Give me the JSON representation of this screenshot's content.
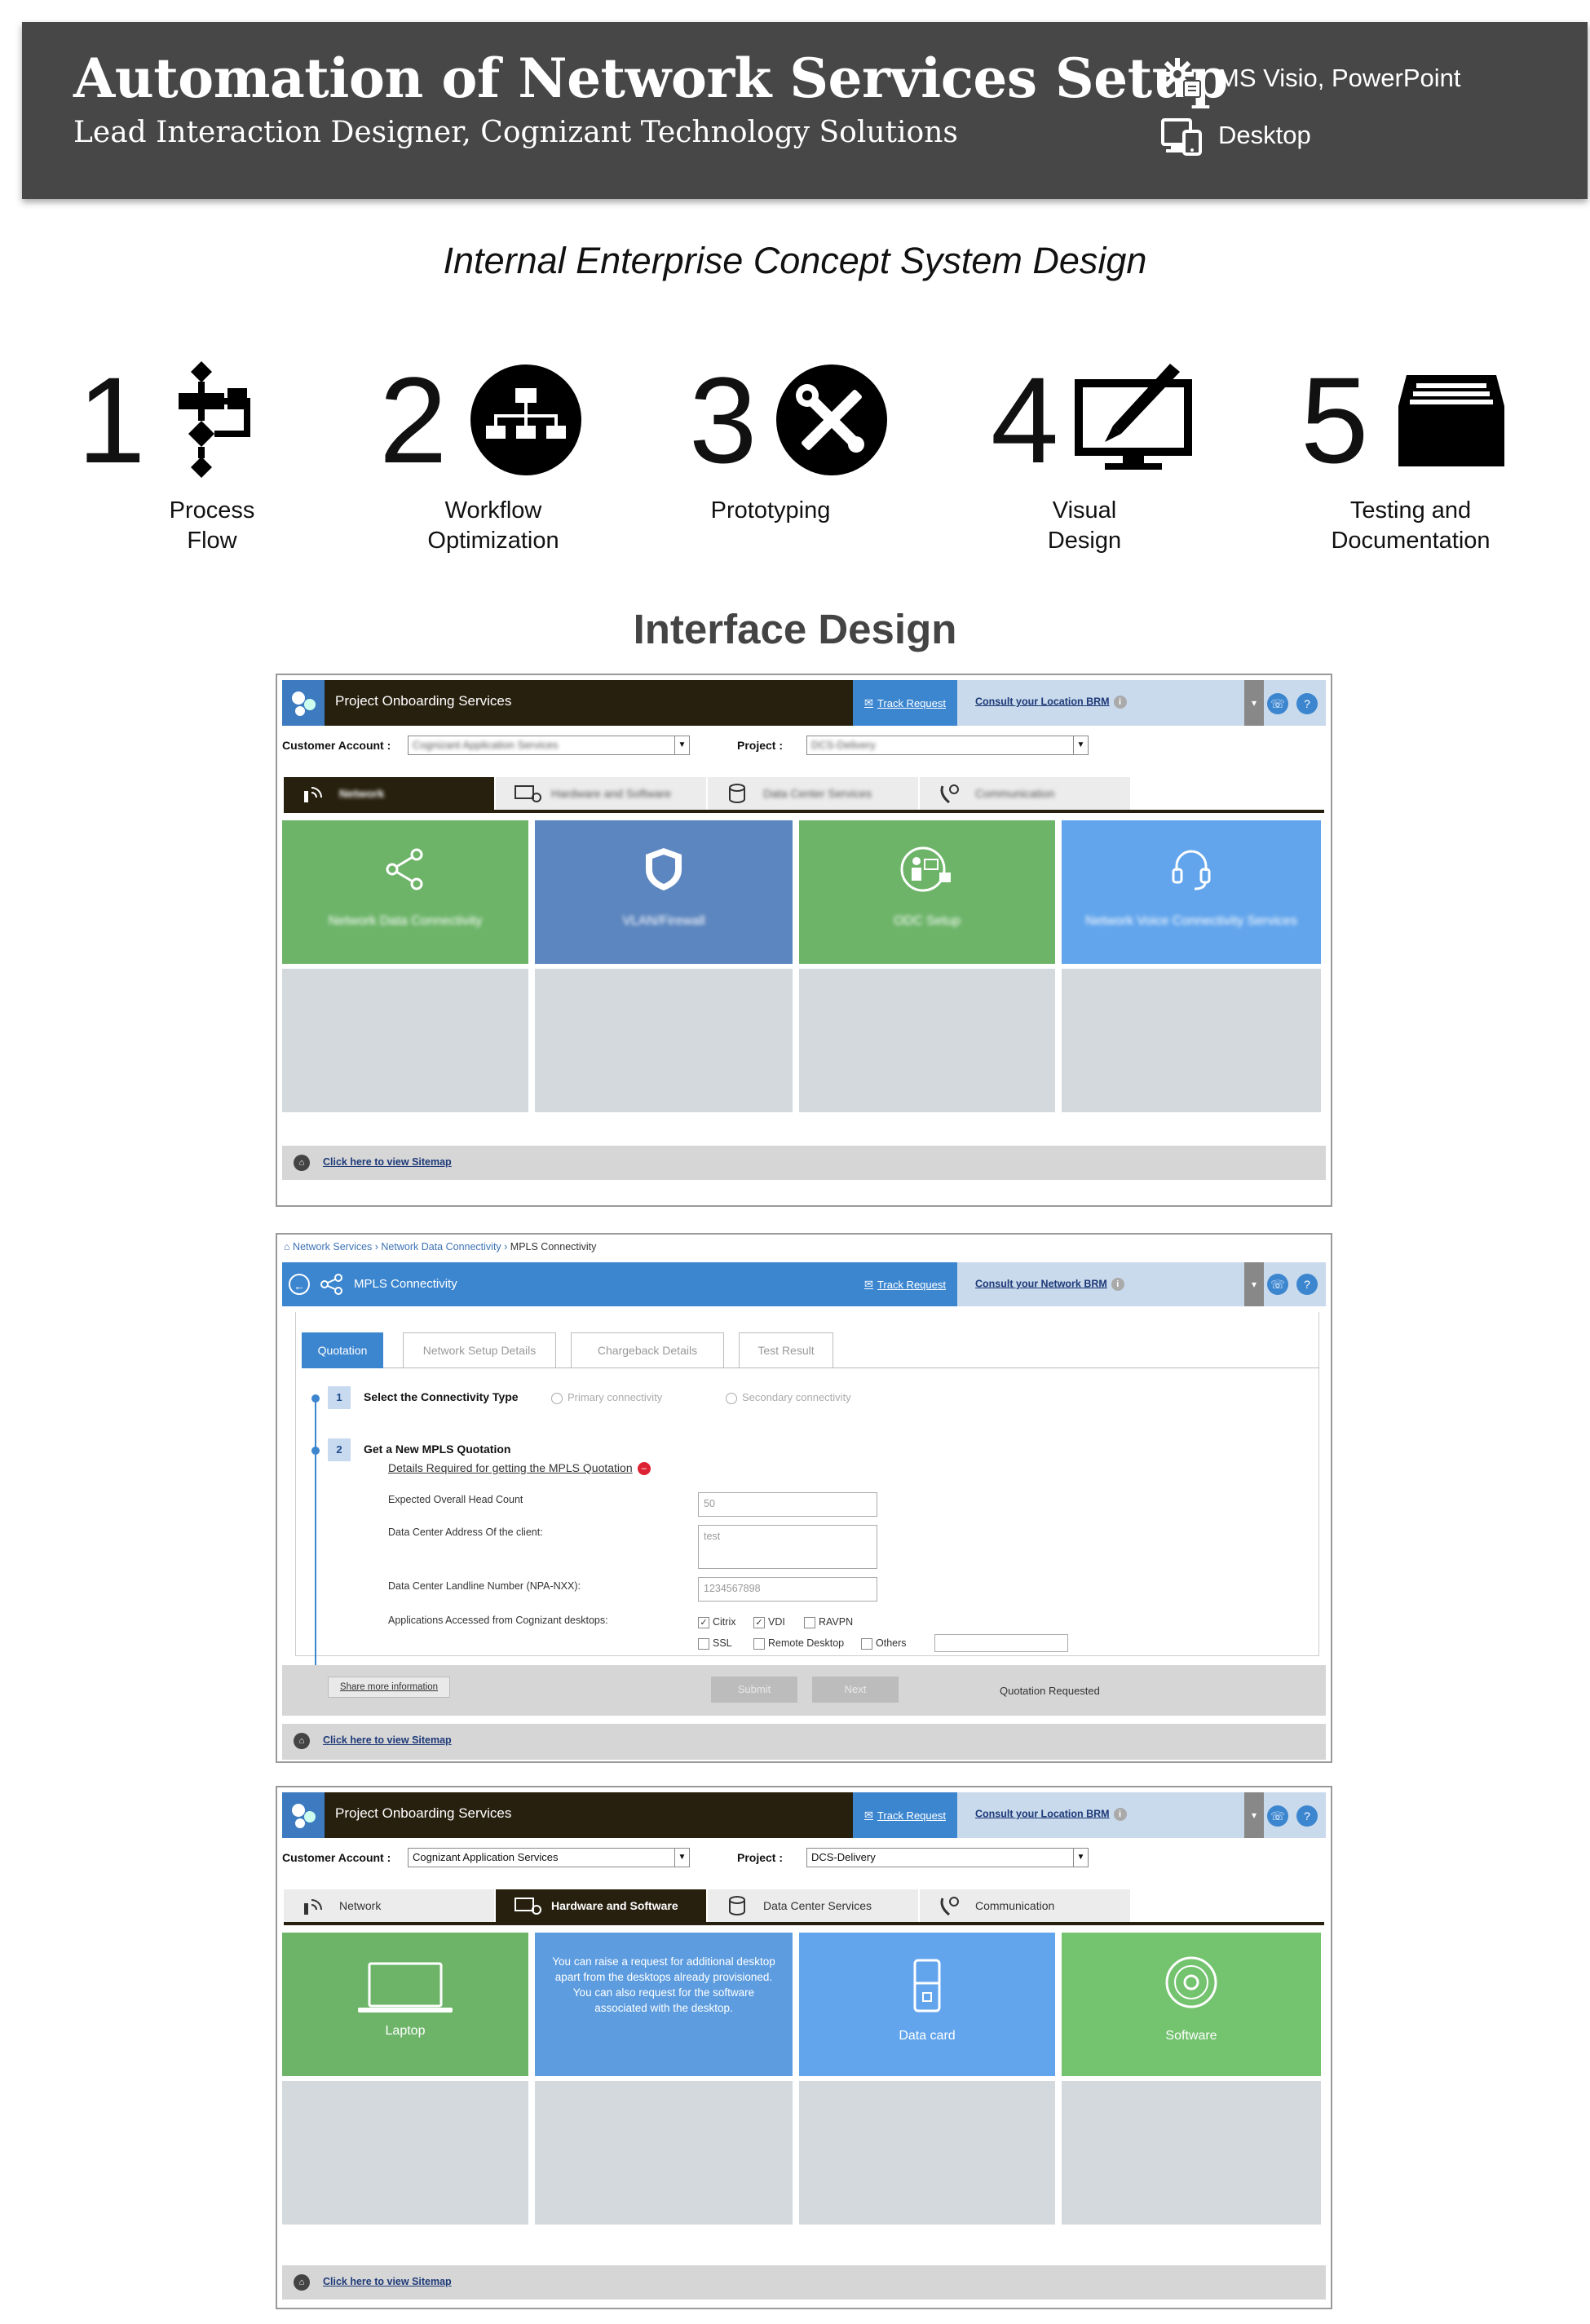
{
  "header": {
    "title": "Automation of Network Services Setup",
    "subtitle": "Lead Interaction Designer, Cognizant Technology Solutions",
    "tools": "MS Visio, PowerPoint",
    "platform": "Desktop"
  },
  "concept_heading": "Internal Enterprise Concept System Design",
  "steps": [
    {
      "num": "1",
      "line1": "Process",
      "line2": "Flow"
    },
    {
      "num": "2",
      "line1": "Workflow",
      "line2": "Optimization"
    },
    {
      "num": "3",
      "line1": "Prototyping",
      "line2": ""
    },
    {
      "num": "4",
      "line1": "Visual",
      "line2": "Design"
    },
    {
      "num": "5",
      "line1": "Testing and",
      "line2": "Documentation"
    }
  ],
  "interface_heading": "Interface Design",
  "screen1": {
    "app_title": "Project Onboarding Services",
    "track_request": "Track Request",
    "consult": "Consult your Location BRM",
    "customer_account_label": "Customer Account :",
    "customer_account_value": "Cognizant Application Services",
    "project_label": "Project :",
    "project_value": "DCS-Delivery",
    "tabs": [
      "Network",
      "Hardware and Software",
      "Data Center Services",
      "Communication"
    ],
    "tiles": [
      "Network Data Connectivity",
      "VLAN/Firewall",
      "ODC Setup",
      "Network Voice Connectivity Services"
    ],
    "sitemap": "Click here to view Sitemap"
  },
  "screen2": {
    "breadcrumb_1": "Network Services",
    "breadcrumb_2": "Network Data Connectivity",
    "breadcrumb_3": "MPLS Connectivity",
    "title": "MPLS Connectivity",
    "track_request": "Track Request",
    "consult": "Consult your Network BRM",
    "tabs": [
      "Quotation",
      "Network Setup Details",
      "Chargeback Details",
      "Test Result"
    ],
    "step1_num": "1",
    "step1_label": "Select the Connectivity Type",
    "radio_primary": "Primary connectivity",
    "radio_secondary": "Secondary connectivity",
    "step2_num": "2",
    "step2_label": "Get a New MPLS Quotation",
    "details_link": "Details Required for getting the MPLS Quotation",
    "field_headcount_label": "Expected Overall Head Count",
    "field_headcount_value": "50",
    "field_address_label": "Data Center Address Of the client:",
    "field_address_value": "test",
    "field_landline_label": "Data Center Landline Number (NPA-NXX):",
    "field_landline_value": "1234567898",
    "field_apps_label": "Applications Accessed from Cognizant desktops:",
    "apps": [
      {
        "label": "Citrix",
        "checked": true
      },
      {
        "label": "VDI",
        "checked": true
      },
      {
        "label": "RAVPN",
        "checked": false
      },
      {
        "label": "SSL",
        "checked": false
      },
      {
        "label": "Remote Desktop",
        "checked": false
      },
      {
        "label": "Others",
        "checked": false
      }
    ],
    "share_more": "Share more information",
    "submit": "Submit",
    "next": "Next",
    "status": "Quotation Requested",
    "sitemap": "Click here to view Sitemap"
  },
  "screen3": {
    "app_title": "Project Onboarding Services",
    "track_request": "Track Request",
    "consult": "Consult your Location BRM",
    "customer_account_label": "Customer Account :",
    "customer_account_value": "Cognizant Application Services",
    "project_label": "Project :",
    "project_value": "DCS-Delivery",
    "tabs": [
      "Network",
      "Hardware and Software",
      "Data Center Services",
      "Communication"
    ],
    "tile_laptop": "Laptop",
    "tile_desktop_desc": "You can raise a request for additional desktop apart from the desktops already provisioned. You can also request for the software associated with the desktop.",
    "tile_datacard": "Data card",
    "tile_software": "Software",
    "sitemap": "Click here to view Sitemap"
  },
  "colors": {
    "banner": "#474747",
    "topbar": "#28200e",
    "accent_blue": "#3c86d0",
    "tile_green": "#6db469",
    "tile_blue": "#5c86bf",
    "tile_sky": "#62a5ec",
    "tile_empty": "#d3d9dc"
  }
}
